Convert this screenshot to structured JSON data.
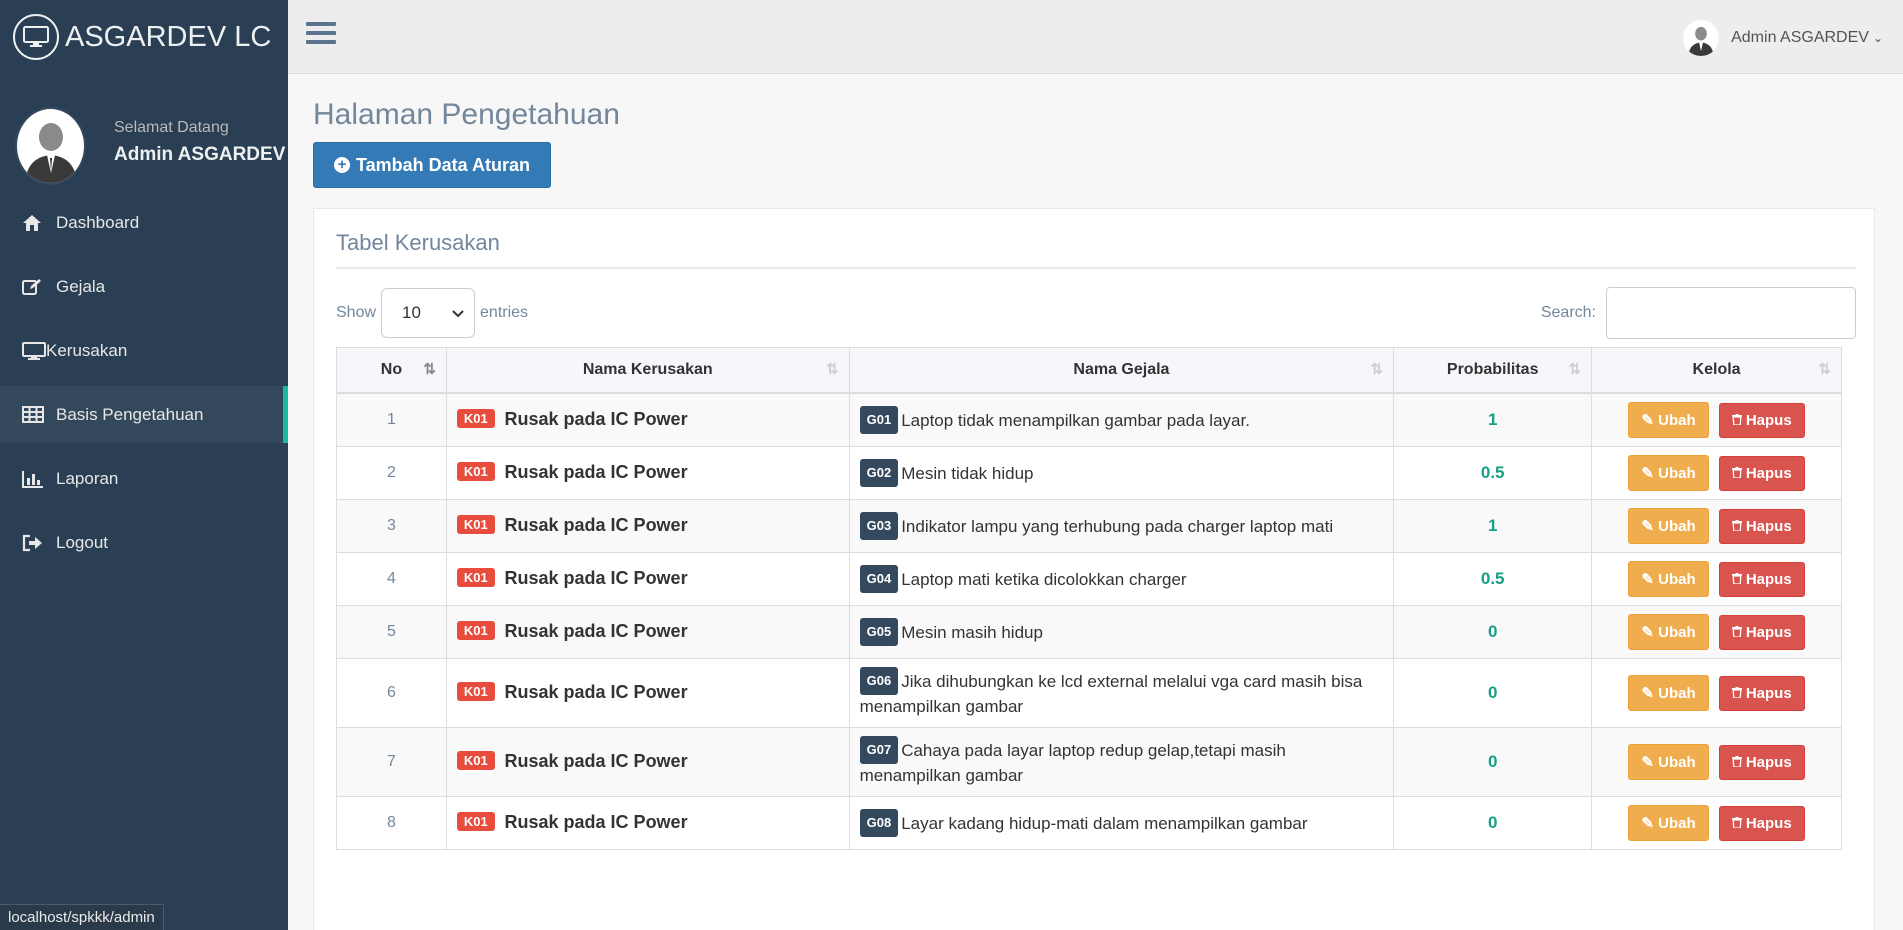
{
  "brand": {
    "title": "ASGARDEV LC"
  },
  "profile": {
    "welcome": "Selamat Datang",
    "name": "Admin ASGARDEV"
  },
  "menu": [
    {
      "label": "Dashboard",
      "icon": "home-icon"
    },
    {
      "label": "Gejala",
      "icon": "edit-icon"
    },
    {
      "label": "Kerusakan",
      "icon": "monitor-icon"
    },
    {
      "label": "Basis Pengetahuan",
      "icon": "table-icon",
      "active": true
    },
    {
      "label": "Laporan",
      "icon": "bar-chart-icon"
    },
    {
      "label": "Logout",
      "icon": "sign-out-icon"
    }
  ],
  "topnav": {
    "user": "Admin ASGARDEV"
  },
  "page": {
    "title": "Halaman Pengetahuan",
    "add_button": "Tambah Data Aturan"
  },
  "panel": {
    "title": "Tabel Kerusakan"
  },
  "controls": {
    "show": "Show",
    "entries_value": "10",
    "entries": "entries",
    "search": "Search:"
  },
  "table": {
    "headers": [
      "No",
      "Nama Kerusakan",
      "Nama Gejala",
      "Probabilitas",
      "Kelola"
    ],
    "rows": [
      {
        "no": "1",
        "k_code": "K01",
        "k_name": "Rusak pada IC Power",
        "g_code": "G01",
        "g_name": "Laptop tidak menampilkan gambar pada layar.",
        "prob": "1"
      },
      {
        "no": "2",
        "k_code": "K01",
        "k_name": "Rusak pada IC Power",
        "g_code": "G02",
        "g_name": "Mesin tidak hidup",
        "prob": "0.5"
      },
      {
        "no": "3",
        "k_code": "K01",
        "k_name": "Rusak pada IC Power",
        "g_code": "G03",
        "g_name": "Indikator lampu yang terhubung pada charger laptop mati",
        "prob": "1"
      },
      {
        "no": "4",
        "k_code": "K01",
        "k_name": "Rusak pada IC Power",
        "g_code": "G04",
        "g_name": "Laptop mati ketika dicolokkan charger",
        "prob": "0.5"
      },
      {
        "no": "5",
        "k_code": "K01",
        "k_name": "Rusak pada IC Power",
        "g_code": "G05",
        "g_name": "Mesin masih hidup",
        "prob": "0"
      },
      {
        "no": "6",
        "k_code": "K01",
        "k_name": "Rusak pada IC Power",
        "g_code": "G06",
        "g_name": "Jika dihubungkan ke lcd external melalui vga card masih bisa menampilkan gambar",
        "prob": "0"
      },
      {
        "no": "7",
        "k_code": "K01",
        "k_name": "Rusak pada IC Power",
        "g_code": "G07",
        "g_name": "Cahaya pada layar laptop redup gelap,tetapi masih menampilkan gambar",
        "prob": "0"
      },
      {
        "no": "8",
        "k_code": "K01",
        "k_name": "Rusak pada IC Power",
        "g_code": "G08",
        "g_name": "Layar kadang hidup-mati dalam menampilkan gambar",
        "prob": "0"
      }
    ],
    "ubah": "Ubah",
    "hapus": "Hapus"
  },
  "status_url": "localhost/spkkk/admin"
}
